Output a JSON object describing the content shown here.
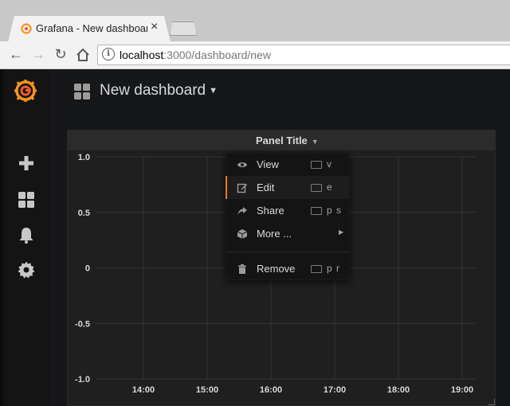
{
  "browser": {
    "tab_title": "Grafana - New dashboard",
    "url_host": "localhost",
    "url_path": ":3000/dashboard/new"
  },
  "dashboard": {
    "title": "New dashboard"
  },
  "panel": {
    "title": "Panel Title"
  },
  "menu": {
    "items": [
      {
        "label": "View",
        "shortcut": "v",
        "icon": "eye-icon"
      },
      {
        "label": "Edit",
        "shortcut": "e",
        "icon": "edit-icon",
        "active": true
      },
      {
        "label": "Share",
        "shortcut": "p s",
        "icon": "share-icon"
      },
      {
        "label": "More ...",
        "icon": "cube-icon"
      },
      {
        "label": "Remove",
        "shortcut": "p r",
        "icon": "trash-icon"
      }
    ]
  },
  "chart_data": {
    "type": "line",
    "series": [],
    "x_tick_labels": [
      "14:00",
      "15:00",
      "16:00",
      "17:00",
      "18:00",
      "19:00"
    ],
    "y_tick_labels": [
      "1.0",
      "0.5",
      "0",
      "-0.5",
      "-1.0"
    ],
    "ylim": [
      -1.0,
      1.0
    ],
    "grid": true
  },
  "colors": {
    "accent": "#eb7b18",
    "background": "#161719",
    "panel": "#1f1f20",
    "text": "#d8d9da"
  }
}
